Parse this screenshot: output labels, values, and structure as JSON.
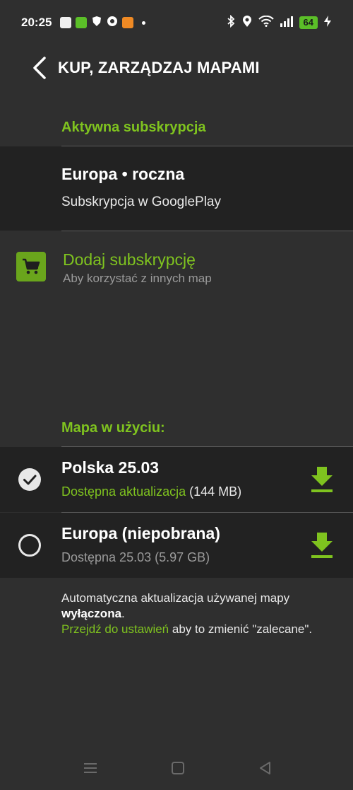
{
  "status_bar": {
    "time": "20:25",
    "battery": "64",
    "icons": [
      "bag-icon",
      "vpn-app-icon",
      "shield-icon",
      "chrome-icon",
      "app-icon",
      "bluetooth-icon",
      "location-icon",
      "wifi-icon",
      "signal-icon",
      "charging-icon"
    ]
  },
  "appbar": {
    "title": "KUP, ZARZĄDZAJ MAPAMI"
  },
  "active_subscription": {
    "header": "Aktywna subskrypcja",
    "title": "Europa • roczna",
    "description": "Subskrypcja w GooglePlay"
  },
  "add_subscription": {
    "title": "Dodaj subskrypcję",
    "description": "Aby korzystać z innych map"
  },
  "maps_in_use": {
    "header": "Mapa w użyciu:",
    "items": [
      {
        "name": "Polska 25.03",
        "selected": true,
        "status_prefix": "Dostępna aktualizacja",
        "status_suffix": " (144 MB)"
      },
      {
        "name": "Europa (niepobrana)",
        "selected": false,
        "status": "Dostępna 25.03 (5.97 GB)"
      }
    ]
  },
  "auto_update": {
    "line1": "Automatyczna aktualizacja używanej mapy",
    "state": "wyłączona",
    "period": ".",
    "link": "Przejdź do ustawień",
    "line2_rest": " aby to zmienić \"zalecane\"."
  },
  "colors": {
    "accent": "#7fc31f",
    "background": "#2f2f2f",
    "card": "#222222"
  }
}
